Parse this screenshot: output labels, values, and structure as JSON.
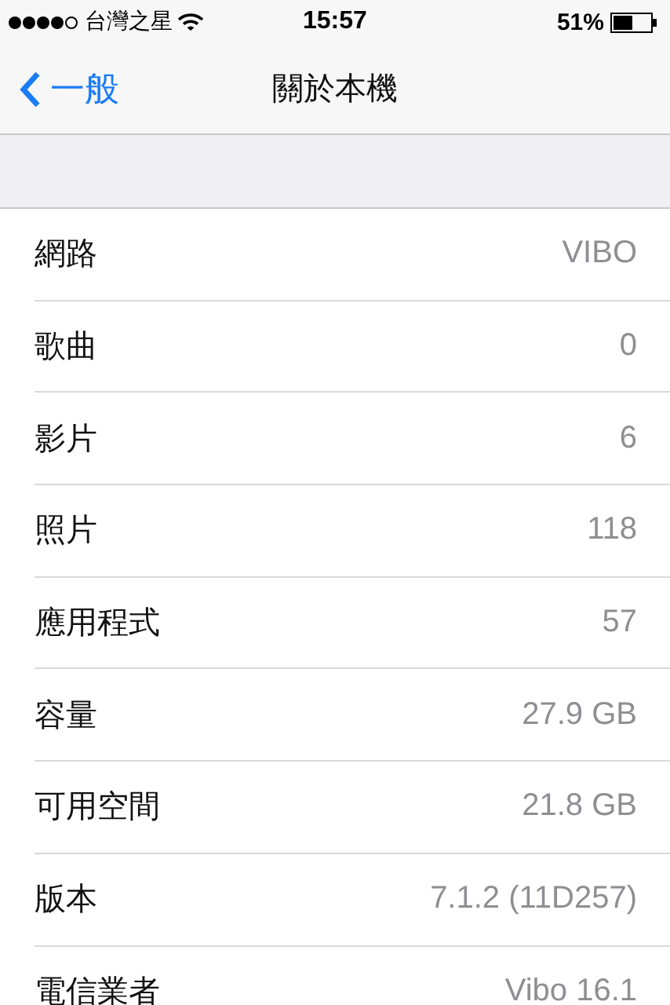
{
  "status_bar": {
    "carrier": "台灣之星",
    "time": "15:57",
    "battery": "51%"
  },
  "nav": {
    "back": "一般",
    "title": "關於本機"
  },
  "rows": [
    {
      "label": "網路",
      "value": "VIBO"
    },
    {
      "label": "歌曲",
      "value": "0"
    },
    {
      "label": "影片",
      "value": "6"
    },
    {
      "label": "照片",
      "value": "118"
    },
    {
      "label": "應用程式",
      "value": "57"
    },
    {
      "label": "容量",
      "value": "27.9 GB"
    },
    {
      "label": "可用空間",
      "value": "21.8 GB"
    },
    {
      "label": "版本",
      "value": "7.1.2 (11D257)"
    },
    {
      "label": "電信業者",
      "value": "Vibo 16.1"
    }
  ]
}
